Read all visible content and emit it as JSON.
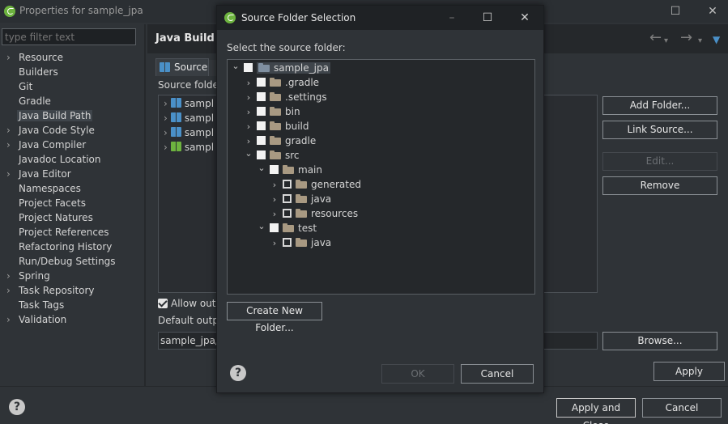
{
  "props_window": {
    "title": "Properties for sample_jpa",
    "filter_placeholder": "type filter text",
    "nav_items": [
      {
        "label": "Resource",
        "expandable": true
      },
      {
        "label": "Builders",
        "expandable": false
      },
      {
        "label": "Git",
        "expandable": false
      },
      {
        "label": "Gradle",
        "expandable": false
      },
      {
        "label": "Java Build Path",
        "expandable": false,
        "selected": true
      },
      {
        "label": "Java Code Style",
        "expandable": true
      },
      {
        "label": "Java Compiler",
        "expandable": true
      },
      {
        "label": "Javadoc Location",
        "expandable": false
      },
      {
        "label": "Java Editor",
        "expandable": true
      },
      {
        "label": "Namespaces",
        "expandable": false
      },
      {
        "label": "Project Facets",
        "expandable": false
      },
      {
        "label": "Project Natures",
        "expandable": false
      },
      {
        "label": "Project References",
        "expandable": false
      },
      {
        "label": "Refactoring History",
        "expandable": false
      },
      {
        "label": "Run/Debug Settings",
        "expandable": false
      },
      {
        "label": "Spring",
        "expandable": true
      },
      {
        "label": "Task Repository",
        "expandable": true
      },
      {
        "label": "Task Tags",
        "expandable": false
      },
      {
        "label": "Validation",
        "expandable": true
      }
    ],
    "page_title": "Java Build P",
    "tab_source": "Source",
    "source_folders_label": "Source folder",
    "source_rows": [
      "sampl",
      "sampl",
      "sampl",
      "sampl"
    ],
    "buttons": {
      "add_folder": "Add Folder...",
      "link_source": "Link Source...",
      "edit": "Edit...",
      "remove": "Remove",
      "browse": "Browse...",
      "apply": "Apply",
      "apply_and_close": "Apply and Close",
      "cancel": "Cancel"
    },
    "allow_output": "Allow outp",
    "default_output_label": "Default outpu",
    "output_value": "sample_jpa/b",
    "help_glyph": "?"
  },
  "dialog": {
    "title": "Source Folder Selection",
    "prompt": "Select the source folder:",
    "tree": [
      {
        "label": "sample_jpa",
        "level": 0,
        "chev": "expanded",
        "box": "white",
        "selected": true,
        "root": true
      },
      {
        "label": ".gradle",
        "level": 1,
        "chev": "collapsed",
        "box": "white"
      },
      {
        "label": ".settings",
        "level": 1,
        "chev": "collapsed",
        "box": "white"
      },
      {
        "label": "bin",
        "level": 1,
        "chev": "collapsed",
        "box": "white"
      },
      {
        "label": "build",
        "level": 1,
        "chev": "collapsed",
        "box": "white"
      },
      {
        "label": "gradle",
        "level": 1,
        "chev": "collapsed",
        "box": "white"
      },
      {
        "label": "src",
        "level": 1,
        "chev": "expanded",
        "box": "white"
      },
      {
        "label": "main",
        "level": 2,
        "chev": "expanded",
        "box": "white"
      },
      {
        "label": "generated",
        "level": 3,
        "chev": "collapsed",
        "box": "gray"
      },
      {
        "label": "java",
        "level": 3,
        "chev": "collapsed",
        "box": "gray"
      },
      {
        "label": "resources",
        "level": 3,
        "chev": "collapsed",
        "box": "gray"
      },
      {
        "label": "test",
        "level": 2,
        "chev": "expanded",
        "box": "white"
      },
      {
        "label": "java",
        "level": 3,
        "chev": "collapsed",
        "box": "gray"
      }
    ],
    "create_new_folder": "Create New Folder...",
    "ok": "OK",
    "cancel": "Cancel",
    "help_glyph": "?"
  },
  "colors": {
    "background": "#2f3337",
    "accent_blue": "#4a90c8",
    "spring_green": "#6db33f",
    "folder": "#a89982"
  }
}
